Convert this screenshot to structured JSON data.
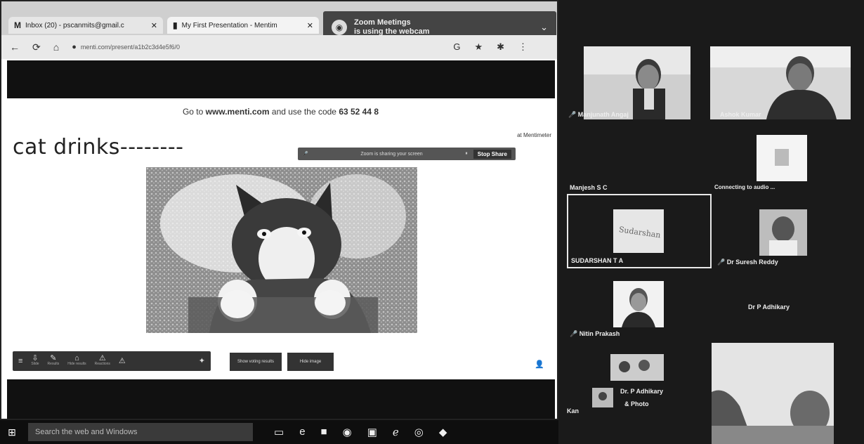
{
  "browser": {
    "tabs": [
      {
        "icon": "M",
        "label": "Inbox (20) - pscanmits@gmail.c",
        "close": "✕"
      },
      {
        "icon": "▮",
        "label": "My First Presentation - Mentim",
        "close": "✕"
      }
    ],
    "zoom_notice": {
      "line1": "Zoom Meetings",
      "line2": "is using the webcam",
      "chevron": "⌄"
    },
    "url": "menti.com/present/a1b2c3d4e5f6/0",
    "nav": {
      "back": "←",
      "reload": "⟳",
      "home": "⌂"
    }
  },
  "slide": {
    "instruction_prefix": "Go to ",
    "instruction_site": "www.menti.com",
    "instruction_middle": " and use the code ",
    "instruction_code": "63 52 44 8",
    "brand": "at Mentimeter",
    "title": "cat drinks--------",
    "share_bar": {
      "label": "Zoom is sharing your screen",
      "stop": "Stop Share"
    },
    "caption_left": "",
    "caption_right": "",
    "toolbar_icons": [
      "≡",
      "⇩",
      "✎",
      "⌂",
      "⚠",
      "⚠"
    ],
    "toolbar_icon_labels": [
      "",
      "Slide",
      "Results",
      "Hide results",
      "Reactions",
      ""
    ],
    "btn1": "Show voting results",
    "btn2": "Hide image",
    "person": "👤"
  },
  "gallery": {
    "participants": [
      {
        "name": "Manjunath Angaj",
        "label_prefix": "🎤"
      },
      {
        "name": "Ashok Kumar",
        "label_prefix": ""
      },
      {
        "name": "Manjesh S C",
        "label_prefix": ""
      },
      {
        "name": "Connecting to audio ...",
        "label_prefix": ""
      },
      {
        "name": "SUDARSHAN T A",
        "label_prefix": ""
      },
      {
        "name": "Dr Suresh Reddy",
        "label_prefix": "🎤"
      },
      {
        "name": "Dr P Adhikary",
        "label_prefix": ""
      },
      {
        "name": "Nitin Prakash",
        "label_prefix": "🎤"
      },
      {
        "name": "Dr. P Adhikary",
        "label_prefix": ""
      },
      {
        "name": "& Photo",
        "label_prefix": ""
      },
      {
        "name": "Kan",
        "label_prefix": ""
      }
    ],
    "sudarshan_sign": "Sudarshan"
  },
  "taskbar": {
    "start": "⊞",
    "search_placeholder": "Search the web and Windows",
    "icons": [
      "▭",
      "e",
      "■",
      "◉",
      "▣",
      "ℯ",
      "◎",
      "◆"
    ]
  }
}
